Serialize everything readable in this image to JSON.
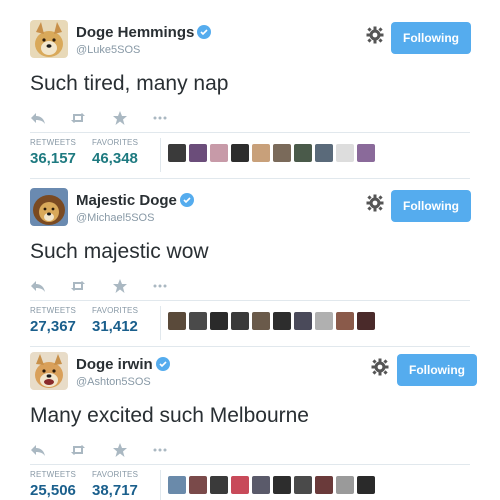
{
  "tweets": [
    {
      "name": "Doge Hemmings",
      "handle": "@Luke5SOS",
      "follow_label": "Following",
      "text": "Such tired, many nap",
      "stats": {
        "retweets_label": "RETWEETS",
        "retweets": "36,157",
        "favorites_label": "FAVORITES",
        "favorites": "46,348"
      },
      "face_colors": [
        "#3a3a3a",
        "#6b4d7a",
        "#c79aa8",
        "#2d2d2d",
        "#c8a07a",
        "#7a6a5a",
        "#4a5a4a",
        "#5a6a7a",
        "#dddddd",
        "#8a6a9a"
      ]
    },
    {
      "name": "Majestic Doge",
      "handle": "@Michael5SOS",
      "follow_label": "Following",
      "text": "Such majestic wow",
      "stats": {
        "retweets_label": "RETWEETS",
        "retweets": "27,367",
        "favorites_label": "FAVORITES",
        "favorites": "31,412"
      },
      "face_colors": [
        "#5a4a3a",
        "#4a4a4a",
        "#2a2a2a",
        "#3a3a3a",
        "#6a5a4a",
        "#2d2d2d",
        "#4a4a5a",
        "#b0b0b0",
        "#8a5a4a",
        "#4a2a2a"
      ]
    },
    {
      "name": "Doge irwin",
      "handle": "@Ashton5SOS",
      "follow_label": "Following",
      "text": "Many excited such Melbourne",
      "stats": {
        "retweets_label": "RETWEETS",
        "retweets": "25,506",
        "favorites_label": "FAVORITES",
        "favorites": "38,717"
      },
      "face_colors": [
        "#6a8aaa",
        "#7a4a4a",
        "#3a3a3a",
        "#c84a5a",
        "#5a5a6a",
        "#2d2d2d",
        "#4a4a4a",
        "#6a3a3a",
        "#9a9a9a",
        "#2a2a2a"
      ]
    }
  ],
  "colors": {
    "accent": "#55acee",
    "stat_value": "#1a5f8c",
    "muted": "#8899a6",
    "text": "#292f33"
  }
}
